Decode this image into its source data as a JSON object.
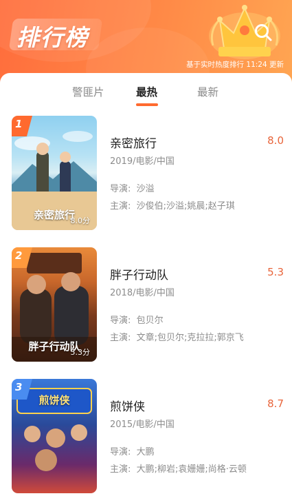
{
  "header": {
    "title": "排行榜",
    "update_text": "基于实时热度排行 11:24 更新",
    "search_icon": "search-icon",
    "crown_icon": "crown-icon"
  },
  "tabs": [
    {
      "label": "警匪片",
      "active": false
    },
    {
      "label": "最热",
      "active": true
    },
    {
      "label": "最新",
      "active": false
    }
  ],
  "colors": {
    "accent": "#ff6a2f",
    "score": "#e8643a"
  },
  "items": [
    {
      "rank": "1",
      "title": "亲密旅行",
      "score": "8.0",
      "meta": "2019/电影/中国",
      "director_label": "导演:",
      "director": "沙溢",
      "cast_label": "主演:",
      "cast": "沙俊伯;沙溢;姚晨;赵子琪",
      "poster_caption": "亲密旅行",
      "poster_score": "8.0分"
    },
    {
      "rank": "2",
      "title": "胖子行动队",
      "score": "5.3",
      "meta": "2018/电影/中国",
      "director_label": "导演:",
      "director": "包贝尔",
      "cast_label": "主演:",
      "cast": "文章;包贝尔;克拉拉;郭京飞",
      "poster_caption": "胖子行动队",
      "poster_score": "5.3分"
    },
    {
      "rank": "3",
      "title": "煎饼侠",
      "score": "8.7",
      "meta": "2015/电影/中国",
      "director_label": "导演:",
      "director": "大鹏",
      "cast_label": "主演:",
      "cast": "大鹏;柳岩;袁姗姗;尚格·云顿",
      "poster_caption": "煎饼侠",
      "poster_score": ""
    }
  ]
}
